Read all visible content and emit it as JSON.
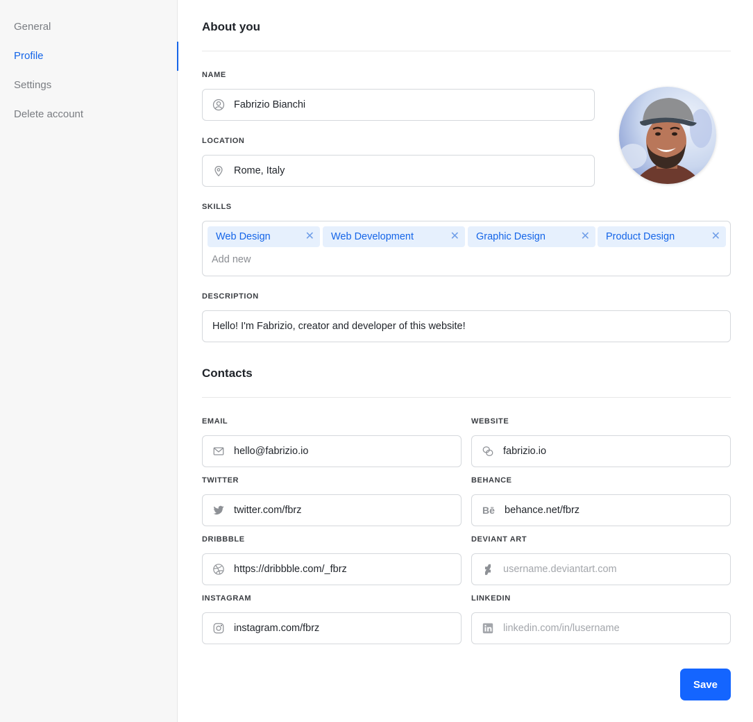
{
  "sidebar": {
    "items": [
      {
        "label": "General",
        "active": false
      },
      {
        "label": "Profile",
        "active": true
      },
      {
        "label": "Settings",
        "active": false
      },
      {
        "label": "Delete account",
        "active": false
      }
    ]
  },
  "about": {
    "title": "About you",
    "name": {
      "label": "NAME",
      "value": "Fabrizio Bianchi",
      "icon": "user-circle-icon"
    },
    "location": {
      "label": "LOCATION",
      "value": "Rome, Italy",
      "icon": "map-pin-icon"
    },
    "skills": {
      "label": "SKILLS",
      "tags": [
        "Web Design",
        "Web Development",
        "Graphic Design",
        "Product Design"
      ],
      "remove_glyph": "✕",
      "placeholder": "Add new"
    },
    "description": {
      "label": "DESCRIPTION",
      "value": "Hello! I'm Fabrizio, creator and developer of this website!"
    }
  },
  "contacts": {
    "title": "Contacts",
    "email": {
      "label": "EMAIL",
      "value": "hello@fabrizio.io",
      "placeholder": "",
      "icon": "mail-icon"
    },
    "website": {
      "label": "WEBSITE",
      "value": "fabrizio.io",
      "placeholder": "",
      "icon": "link-icon"
    },
    "twitter": {
      "label": "TWITTER",
      "value": "twitter.com/fbrz",
      "placeholder": "",
      "icon": "twitter-icon"
    },
    "behance": {
      "label": "BEHANCE",
      "value": "behance.net/fbrz",
      "placeholder": "",
      "icon": "behance-icon",
      "glyph": "Bē"
    },
    "dribbble": {
      "label": "DRIBBBLE",
      "value": "https://dribbble.com/_fbrz",
      "placeholder": "",
      "icon": "dribbble-icon"
    },
    "deviantart": {
      "label": "DEVIANT ART",
      "value": "",
      "placeholder": "username.deviantart.com",
      "icon": "deviantart-icon"
    },
    "instagram": {
      "label": "INSTAGRAM",
      "value": "instagram.com/fbrz",
      "placeholder": "",
      "icon": "instagram-icon"
    },
    "linkedin": {
      "label": "LINKEDIN",
      "value": "",
      "placeholder": "linkedin.com/in/lusername",
      "icon": "linkedin-icon"
    }
  },
  "actions": {
    "save_label": "Save"
  },
  "colors": {
    "accent": "#1465ff",
    "link_active": "#1565e8",
    "chip_bg": "#e6f0fd",
    "icon_gray": "#8e9196"
  }
}
